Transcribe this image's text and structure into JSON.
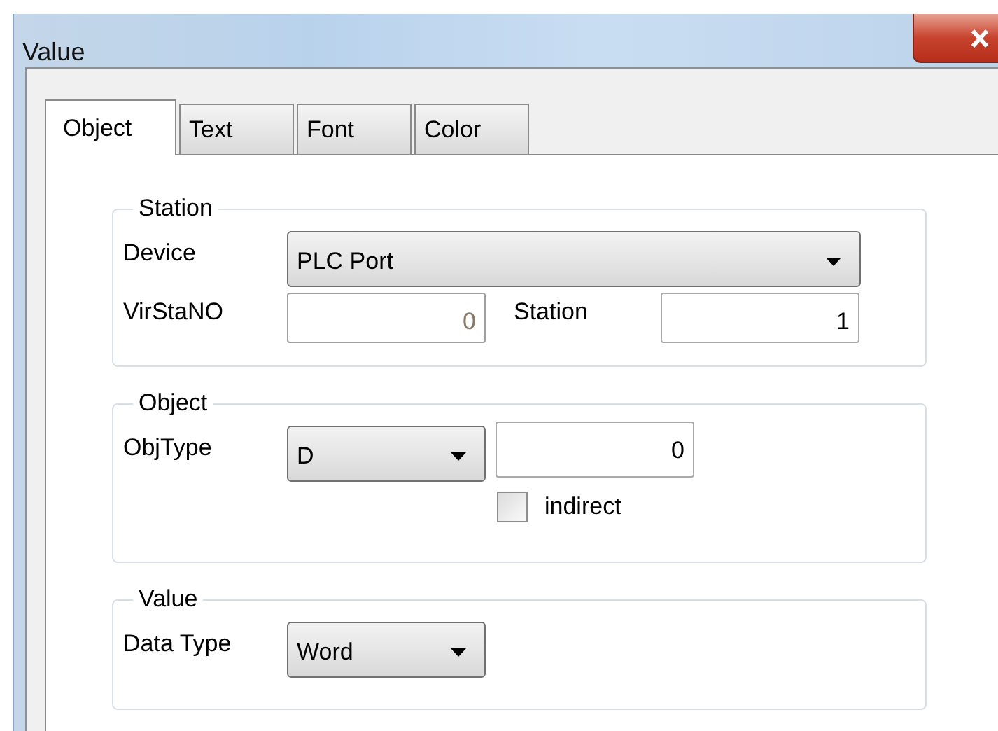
{
  "window": {
    "title": "Value"
  },
  "tabs": [
    {
      "label": "Object",
      "selected": true
    },
    {
      "label": "Text",
      "selected": false
    },
    {
      "label": "Font",
      "selected": false
    },
    {
      "label": "Color",
      "selected": false
    }
  ],
  "station": {
    "title": "Station",
    "device": {
      "label": "Device",
      "value": "PLC Port"
    },
    "virstano": {
      "label": "VirStaNO",
      "value": "0",
      "disabled": true
    },
    "station_no": {
      "label": "Station",
      "value": "1",
      "disabled": false
    }
  },
  "object": {
    "title": "Object",
    "obj_type": {
      "label": "ObjType",
      "value": "D"
    },
    "address": {
      "value": "0"
    },
    "indirect": {
      "label": "indirect",
      "checked": false
    }
  },
  "value": {
    "title": "Value",
    "data_type": {
      "label": "Data Type",
      "value": "Word"
    }
  }
}
